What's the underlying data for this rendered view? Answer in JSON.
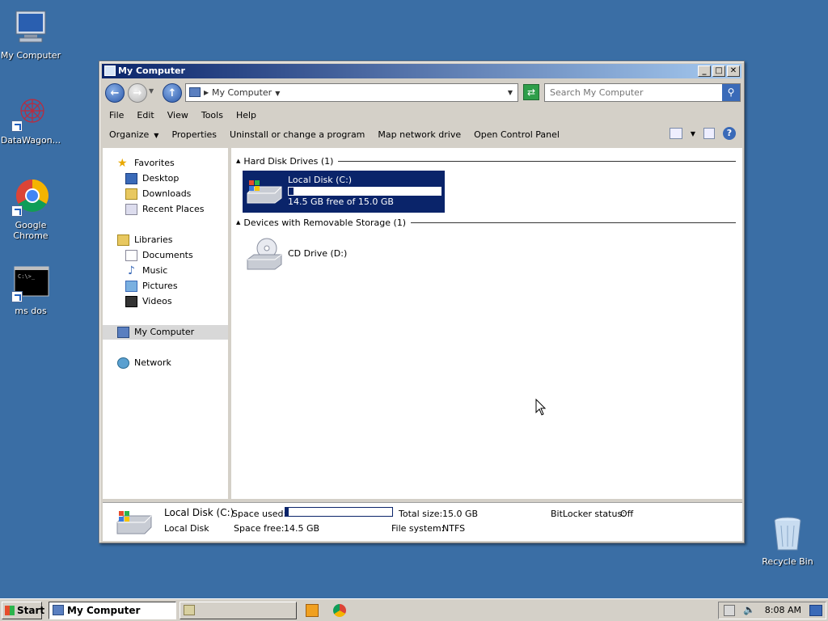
{
  "desktop": {
    "icons": [
      {
        "label": "My Computer",
        "icon": "computer-icon"
      },
      {
        "label": "DataWagon...",
        "icon": "datawagon-icon"
      },
      {
        "label": "Google Chrome",
        "icon": "chrome-icon"
      },
      {
        "label": "ms dos",
        "icon": "msdos-icon"
      },
      {
        "label": "Recycle Bin",
        "icon": "recycle-bin-icon"
      }
    ]
  },
  "window": {
    "title": "My Computer",
    "controls": {
      "minimize": "_",
      "maximize": "□",
      "close": "✕"
    },
    "address": "My Computer",
    "search_placeholder": "Search My Computer",
    "menu": [
      "File",
      "Edit",
      "View",
      "Tools",
      "Help"
    ],
    "commands": [
      "Organize",
      "Properties",
      "Uninstall or change a program",
      "Map network drive",
      "Open Control Panel"
    ]
  },
  "nav": {
    "favorites": "Favorites",
    "favorites_items": [
      "Desktop",
      "Downloads",
      "Recent Places"
    ],
    "libraries": "Libraries",
    "libraries_items": [
      "Documents",
      "Music",
      "Pictures",
      "Videos"
    ],
    "my_computer": "My Computer",
    "network": "Network"
  },
  "content": {
    "group_hdd": "Hard Disk Drives (1)",
    "group_removable": "Devices with Removable Storage (1)",
    "drive_c": {
      "name": "Local Disk (C:)",
      "free_text": "14.5 GB free of 15.0 GB",
      "used_fraction": 0.03
    },
    "drive_d": {
      "name": "CD Drive (D:)"
    }
  },
  "details": {
    "name": "Local Disk (C:)",
    "type": "Local Disk",
    "space_used_label": "Space used:",
    "space_free_label": "Space free:",
    "space_free_value": "14.5 GB",
    "total_size_label": "Total size:",
    "total_size_value": "15.0 GB",
    "filesystem_label": "File system:",
    "filesystem_value": "NTFS",
    "bitlocker_label": "BitLocker status:",
    "bitlocker_value": "Off"
  },
  "taskbar": {
    "start": "Start",
    "active_task": "My Computer",
    "clock": "8:08 AM"
  },
  "colors": {
    "desktop": "#3a6ea5",
    "selection": "#0a246a",
    "titlebar": "#0a246a"
  }
}
